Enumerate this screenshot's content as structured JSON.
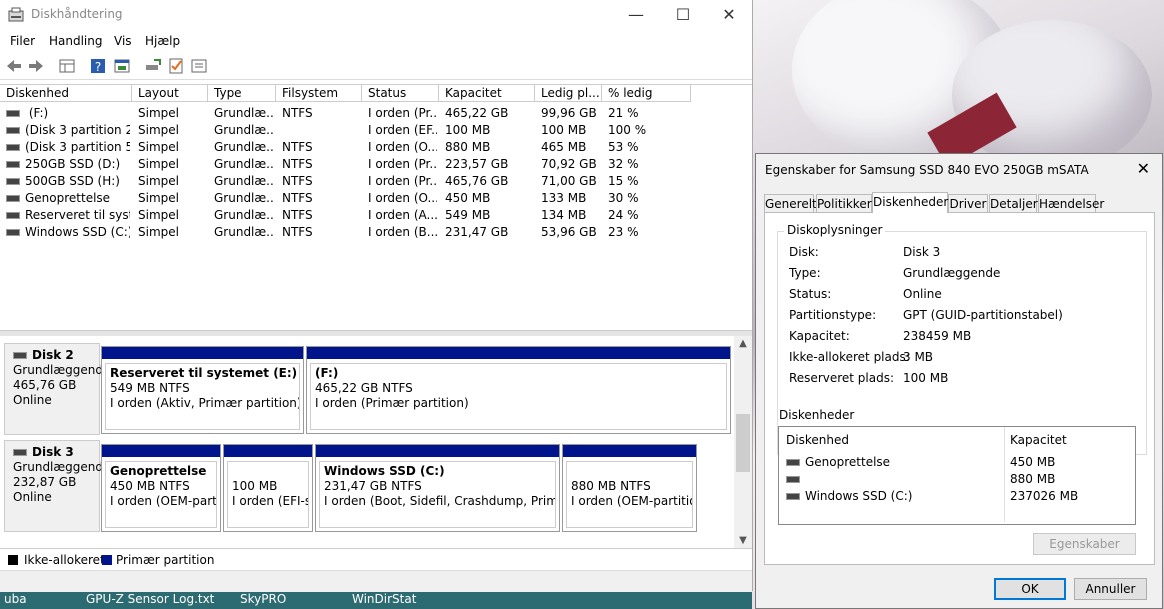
{
  "main_window": {
    "title": "Diskhåndtering",
    "controls": {
      "minimize": "—",
      "maximize": "☐",
      "close": "✕"
    }
  },
  "menu": [
    "Filer",
    "Handling",
    "Vis",
    "Hjælp"
  ],
  "toolbar_icons": [
    "back-icon",
    "forward-icon",
    "volume-view-icon",
    "help-icon",
    "console-icon",
    "rescan-icon",
    "checklist-icon",
    "properties-icon"
  ],
  "volume_list": {
    "columns": [
      "Diskenhed",
      "Layout",
      "Type",
      "Filsystem",
      "Status",
      "Kapacitet",
      "Ledig pl...",
      "% ledig"
    ],
    "rows": [
      {
        "name": " (F:)",
        "layout": "Simpel",
        "type": "Grundlæ...",
        "fs": "NTFS",
        "status": "I orden (Pr...",
        "cap": "465,22 GB",
        "free": "99,96 GB",
        "pct": "21 %"
      },
      {
        "name": "(Disk 3 partition 2)",
        "layout": "Simpel",
        "type": "Grundlæ...",
        "fs": "",
        "status": "I orden (EF...",
        "cap": "100 MB",
        "free": "100 MB",
        "pct": "100 %"
      },
      {
        "name": "(Disk 3 partition 5)",
        "layout": "Simpel",
        "type": "Grundlæ...",
        "fs": "NTFS",
        "status": "I orden (O...",
        "cap": "880 MB",
        "free": "465 MB",
        "pct": "53 %"
      },
      {
        "name": "250GB SSD (D:)",
        "layout": "Simpel",
        "type": "Grundlæ...",
        "fs": "NTFS",
        "status": "I orden (Pr...",
        "cap": "223,57 GB",
        "free": "70,92 GB",
        "pct": "32 %"
      },
      {
        "name": "500GB SSD (H:)",
        "layout": "Simpel",
        "type": "Grundlæ...",
        "fs": "NTFS",
        "status": "I orden (Pr...",
        "cap": "465,76 GB",
        "free": "71,00 GB",
        "pct": "15 %"
      },
      {
        "name": "Genoprettelse",
        "layout": "Simpel",
        "type": "Grundlæ...",
        "fs": "NTFS",
        "status": "I orden (O...",
        "cap": "450 MB",
        "free": "133 MB",
        "pct": "30 %"
      },
      {
        "name": "Reserveret til syste...",
        "layout": "Simpel",
        "type": "Grundlæ...",
        "fs": "NTFS",
        "status": "I orden (A...",
        "cap": "549 MB",
        "free": "134 MB",
        "pct": "24 %"
      },
      {
        "name": "Windows SSD  (C:)",
        "layout": "Simpel",
        "type": "Grundlæ...",
        "fs": "NTFS",
        "status": "I orden (B...",
        "cap": "231,47 GB",
        "free": "53,96 GB",
        "pct": "23 %"
      }
    ]
  },
  "disks": [
    {
      "label": "Disk 2",
      "type": "Grundlæggend",
      "size": "465,76 GB",
      "status": "Online",
      "partitions": [
        {
          "name": "Reserveret til systemet  (E:)",
          "size": "549 MB NTFS",
          "status": "I orden (Aktiv, Primær partition)"
        },
        {
          "name": " (F:)",
          "size": "465,22 GB NTFS",
          "status": "I orden (Primær partition)"
        }
      ]
    },
    {
      "label": "Disk 3",
      "type": "Grundlæggend",
      "size": "232,87 GB",
      "status": "Online",
      "partitions": [
        {
          "name": "Genoprettelse",
          "size": "450 MB NTFS",
          "status": "I orden (OEM-partiti"
        },
        {
          "name": "",
          "size": "100 MB",
          "status": "I orden (EFI-sy"
        },
        {
          "name": "Windows SSD  (C:)",
          "size": "231,47 GB NTFS",
          "status": "I orden (Boot, Sidefil, Crashdump, Primær p"
        },
        {
          "name": "",
          "size": "880 MB NTFS",
          "status": "I orden (OEM-partition)"
        }
      ]
    }
  ],
  "legend": [
    {
      "label": "Ikke-allokeret",
      "color": "#000000"
    },
    {
      "label": "Primær partition",
      "color": "#00148c"
    }
  ],
  "desktop_labels": [
    "uba",
    "GPU-Z Sensor Log.txt",
    "SkyPRO",
    "WinDirStat"
  ],
  "dialog": {
    "title": "Egenskaber for Samsung SSD 840 EVO 250GB mSATA",
    "close": "✕",
    "tabs": [
      "Generelt",
      "Politikker",
      "Diskenheder",
      "Driver",
      "Detaljer",
      "Hændelser"
    ],
    "active_tab": "Diskenheder",
    "group_title": "Diskoplysninger",
    "info": [
      {
        "k": "Disk:",
        "v": "Disk 3"
      },
      {
        "k": "Type:",
        "v": "Grundlæggende"
      },
      {
        "k": "Status:",
        "v": "Online"
      },
      {
        "k": "Partitionstype:",
        "v": "GPT (GUID-partitionstabel)"
      },
      {
        "k": "Kapacitet:",
        "v": "238459 MB"
      },
      {
        "k": "Ikke-allokeret plads:",
        "v": "3 MB"
      },
      {
        "k": "Reserveret plads:",
        "v": "100 MB"
      }
    ],
    "volumes_title": "Diskenheder",
    "vol_columns": [
      "Diskenhed",
      "Kapacitet"
    ],
    "volumes": [
      {
        "name": "Genoprettelse",
        "cap": "450 MB"
      },
      {
        "name": "",
        "cap": "880 MB"
      },
      {
        "name": "Windows SSD  (C:)",
        "cap": "237026 MB"
      }
    ],
    "properties_button": "Egenskaber",
    "ok": "OK",
    "cancel": "Annuller"
  }
}
